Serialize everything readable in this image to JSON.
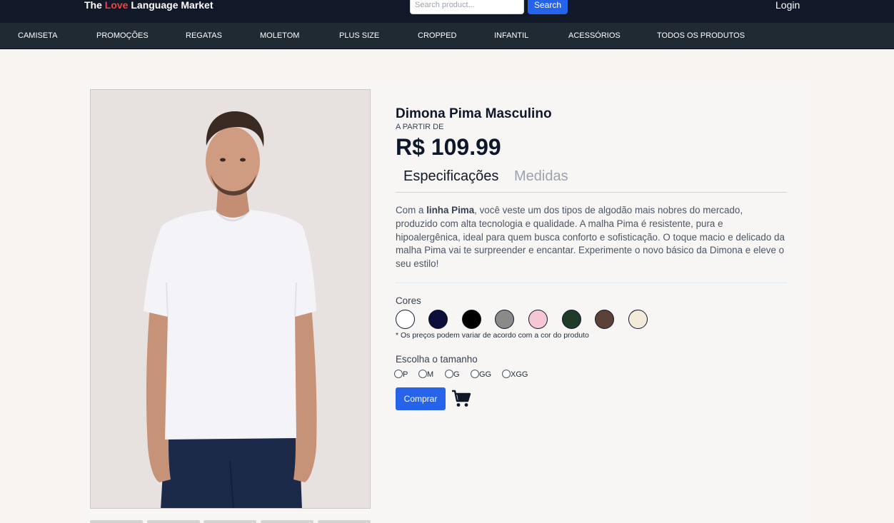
{
  "header": {
    "brand_prefix": "The",
    "brand_love": "Love",
    "brand_suffix": "Language Market",
    "search_placeholder": "Search product...",
    "search_button": "Search",
    "login": "Login"
  },
  "nav": {
    "items": [
      "CAMISETA",
      "PROMOÇÕES",
      "REGATAS",
      "MOLETOM",
      "PLUS SIZE",
      "CROPPED",
      "INFANTIL",
      "ACESSÓRIOS",
      "TODOS OS PRODUTOS"
    ]
  },
  "product": {
    "title": "Dimona Pima Masculino",
    "from_label": "A PARTIR DE",
    "price": "R$ 109.99",
    "tabs": [
      {
        "label": "Especificações",
        "active": true
      },
      {
        "label": "Medidas",
        "active": false
      }
    ],
    "description_lead": "Com a",
    "description_bold": "linha Pima",
    "description_rest": ", você veste um dos tipos de algodão mais nobres do mercado, produzido com alta tecnologia e qualidade. A malha Pima é resistente, pura e hipoalergênica, ideal para quem busca conforto e sofisticação. O toque macio e delicado da malha Pima vai te surpreender e encantar. Experimente o novo básico da Dimona e eleve o seu estilo!",
    "colors_label": "Cores",
    "colors": [
      "#ffffff",
      "#0b0f3a",
      "#000000",
      "#8a8a8a",
      "#f7c6d6",
      "#1f3b2a",
      "#5b4238",
      "#f3ead8"
    ],
    "price_note": "* Os preços podem variar de acordo com a cor do produto",
    "size_label": "Escolha o tamanho",
    "sizes": [
      "P",
      "M",
      "G",
      "GG",
      "XGG"
    ],
    "buy_button": "Comprar",
    "cart_icon": "shopping-cart-icon"
  },
  "colors": {
    "header_bg": "#111827",
    "nav_bg": "#1f2a33",
    "accent": "#2563eb",
    "brand_love": "#ef4444"
  }
}
